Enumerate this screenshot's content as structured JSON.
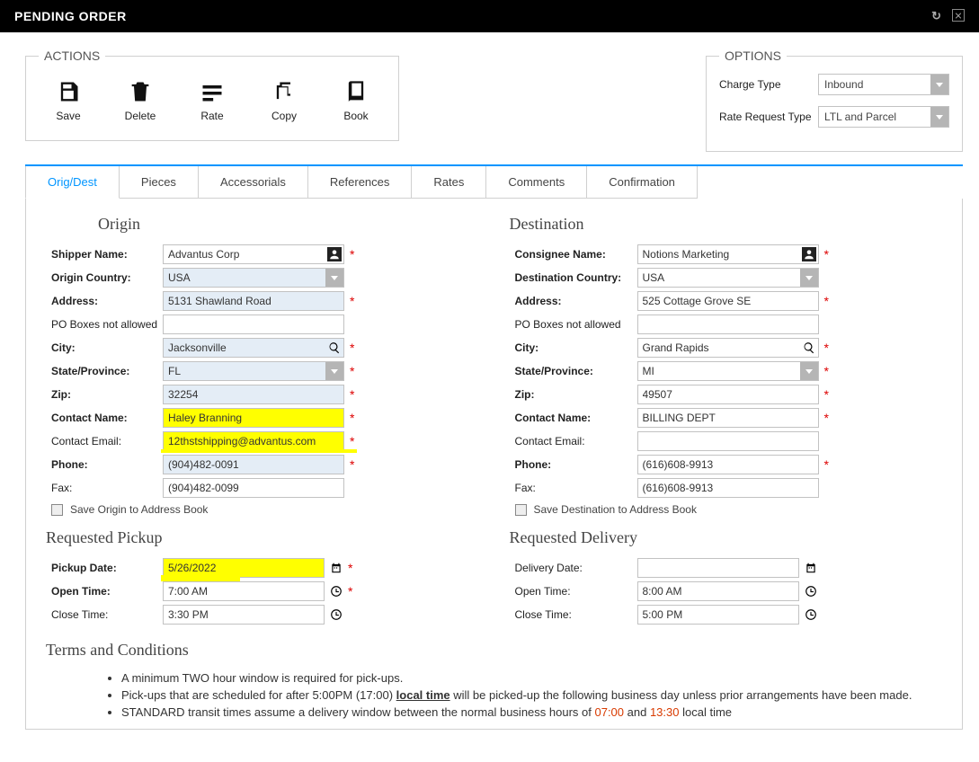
{
  "header": {
    "title": "PENDING ORDER"
  },
  "actions": {
    "legend": "ACTIONS",
    "save": "Save",
    "delete": "Delete",
    "rate": "Rate",
    "copy": "Copy",
    "book": "Book"
  },
  "options": {
    "legend": "OPTIONS",
    "chargeType": {
      "label": "Charge Type",
      "value": "Inbound"
    },
    "rateRequestType": {
      "label": "Rate Request Type",
      "value": "LTL and Parcel"
    }
  },
  "tabs": {
    "origDest": "Orig/Dest",
    "pieces": "Pieces",
    "accessorials": "Accessorials",
    "references": "References",
    "rates": "Rates",
    "comments": "Comments",
    "confirmation": "Confirmation"
  },
  "origin": {
    "heading": "Origin",
    "shipperName": {
      "label": "Shipper Name:",
      "value": "Advantus Corp"
    },
    "country": {
      "label": "Origin Country:",
      "value": "USA"
    },
    "address": {
      "label": "Address:",
      "value": "5131 Shawland Road"
    },
    "poBoxes": {
      "label": "PO Boxes not allowed",
      "value": ""
    },
    "city": {
      "label": "City:",
      "value": "Jacksonville"
    },
    "state": {
      "label": "State/Province:",
      "value": "FL"
    },
    "zip": {
      "label": "Zip:",
      "value": "32254"
    },
    "contactName": {
      "label": "Contact Name:",
      "value": "Haley Branning"
    },
    "contactEmail": {
      "label": "Contact Email:",
      "value": "12thstshipping@advantus.com"
    },
    "phone": {
      "label": "Phone:",
      "value": "(904)482-0091"
    },
    "fax": {
      "label": "Fax:",
      "value": "(904)482-0099"
    },
    "saveAddr": "Save Origin to Address Book"
  },
  "destination": {
    "heading": "Destination",
    "consigneeName": {
      "label": "Consignee Name:",
      "value": "Notions Marketing"
    },
    "country": {
      "label": "Destination Country:",
      "value": "USA"
    },
    "address": {
      "label": "Address:",
      "value": "525 Cottage Grove SE"
    },
    "poBoxes": {
      "label": "PO Boxes not allowed",
      "value": ""
    },
    "city": {
      "label": "City:",
      "value": "Grand Rapids"
    },
    "state": {
      "label": "State/Province:",
      "value": "MI"
    },
    "zip": {
      "label": "Zip:",
      "value": "49507"
    },
    "contactName": {
      "label": "Contact Name:",
      "value": "BILLING DEPT"
    },
    "contactEmail": {
      "label": "Contact Email:",
      "value": ""
    },
    "phone": {
      "label": "Phone:",
      "value": "(616)608-9913"
    },
    "fax": {
      "label": "Fax:",
      "value": "(616)608-9913"
    },
    "saveAddr": "Save Destination to Address Book"
  },
  "pickup": {
    "heading": "Requested Pickup",
    "date": {
      "label": "Pickup Date:",
      "value": "5/26/2022"
    },
    "open": {
      "label": "Open Time:",
      "value": "7:00 AM"
    },
    "close": {
      "label": "Close Time:",
      "value": "3:30 PM"
    }
  },
  "delivery": {
    "heading": "Requested Delivery",
    "date": {
      "label": "Delivery Date:",
      "value": ""
    },
    "open": {
      "label": "Open Time:",
      "value": "8:00 AM"
    },
    "close": {
      "label": "Close Time:",
      "value": "5:00 PM"
    }
  },
  "terms": {
    "heading": "Terms and Conditions",
    "b1": "A minimum TWO hour window is required for pick-ups.",
    "b2a": "Pick-ups that are scheduled for after 5:00PM (17:00) ",
    "b2b": "local time",
    "b2c": " will be picked-up the following business day unless prior arrangements have been made.",
    "b3a": "STANDARD transit times assume a delivery window between the normal business hours of ",
    "b3b": "07:00",
    "b3c": " and ",
    "b3d": "13:30",
    "b3e": " local time"
  }
}
